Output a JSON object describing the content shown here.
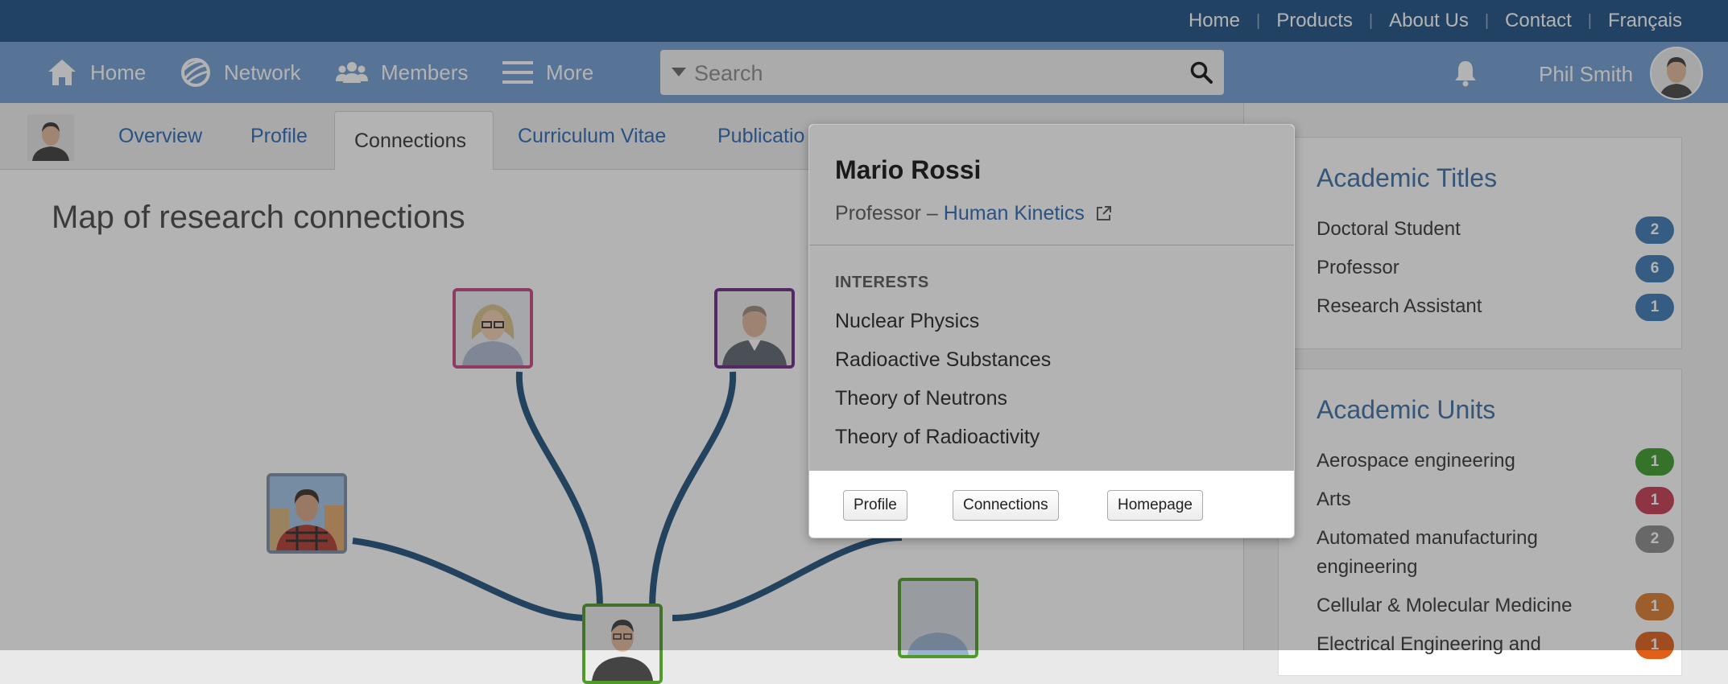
{
  "topbar": {
    "links": [
      {
        "label": "Home"
      },
      {
        "label": "Products"
      },
      {
        "label": "About Us"
      },
      {
        "label": "Contact"
      },
      {
        "label": "Français"
      }
    ]
  },
  "nav": {
    "items": [
      {
        "label": "Home",
        "icon": "home-icon"
      },
      {
        "label": "Network",
        "icon": "network-icon"
      },
      {
        "label": "Members",
        "icon": "members-icon"
      },
      {
        "label": "More",
        "icon": "hamburger-icon"
      }
    ],
    "search_placeholder": "Search",
    "user_name": "Phil Smith"
  },
  "tabs": [
    {
      "label": "Overview"
    },
    {
      "label": "Profile"
    },
    {
      "label": "Connections",
      "active": true
    },
    {
      "label": "Curriculum Vitae"
    },
    {
      "label": "Publicatio"
    }
  ],
  "map": {
    "title": "Map of research connections"
  },
  "popover": {
    "name": "Mario Rossi",
    "role_prefix": "Professor – ",
    "department": "Human Kinetics",
    "interests_title": "INTERESTS",
    "interests": [
      "Nuclear Physics",
      "Radioactive Substances",
      "Theory of Neutrons",
      "Theory of Radioactivity"
    ],
    "buttons": [
      "Profile",
      "Connections",
      "Homepage"
    ]
  },
  "academic_titles": {
    "heading": "Academic Titles",
    "items": [
      {
        "label": "Doctoral Student",
        "count": "2",
        "color": "#3a78b5"
      },
      {
        "label": "Professor",
        "count": "6",
        "color": "#3a78b5"
      },
      {
        "label": "Research Assistant",
        "count": "1",
        "color": "#3a78b5"
      }
    ]
  },
  "academic_units": {
    "heading": "Academic Units",
    "items": [
      {
        "label": "Aerospace engineering",
        "count": "1",
        "color": "#3a9a2a"
      },
      {
        "label": "Arts",
        "count": "1",
        "color": "#c63a50"
      },
      {
        "label": "Automated manufacturing engineering",
        "count": "2",
        "color": "#8a8a8a"
      },
      {
        "label": "Cellular & Molecular Medicine",
        "count": "1",
        "color": "#dc7a2c"
      },
      {
        "label": "Electrical Engineering and",
        "count": "1",
        "color": "#e0601a"
      }
    ]
  },
  "colors": {
    "topbar": "#1b4f83",
    "navbar": "#6f9bd0",
    "connection_line": "#1f4f7a",
    "node_borders": [
      "#c2457e",
      "#6a2a86",
      "#7a8ca4",
      "#4f9a2a",
      "#4f9a2a"
    ]
  }
}
